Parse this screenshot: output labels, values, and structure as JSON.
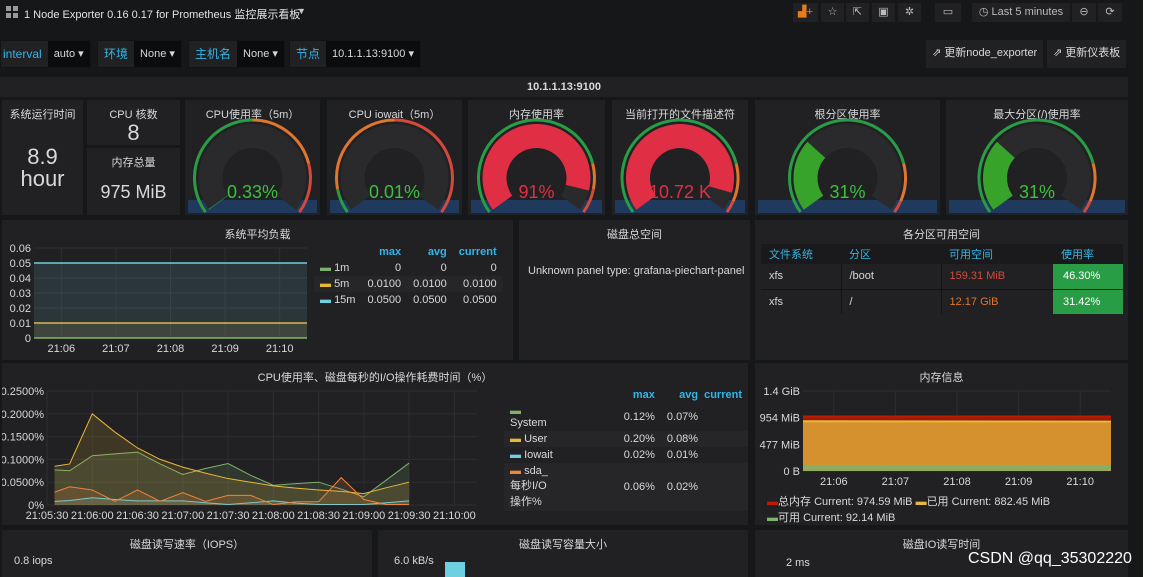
{
  "topbar": {
    "title": "1 Node Exporter 0.16 0.17 for Prometheus 监控展示看板",
    "time_range": "Last 5 minutes"
  },
  "variables": [
    {
      "label": "interval",
      "value": "auto"
    },
    {
      "label": "环境",
      "value": "None"
    },
    {
      "label": "主机名",
      "value": "None"
    },
    {
      "label": "节点",
      "value": "10.1.1.13:9100"
    }
  ],
  "links": [
    "更新node_exporter",
    "更新仪表板"
  ],
  "row_title": "10.1.1.13:9100",
  "stats": {
    "uptime": {
      "title": "系统运行时间",
      "value": "8.9",
      "unit": "hour"
    },
    "cpu_cores": {
      "title": "CPU 核数",
      "value": "8"
    },
    "mem_total": {
      "title": "内存总量",
      "value": "975 MiB"
    }
  },
  "gauges": [
    {
      "title": "CPU使用率（5m）",
      "value": "0.33%",
      "fraction": 0.0033,
      "color": "#299c46",
      "thresholds": [
        [
          "#299c46",
          0.5
        ],
        [
          "#e0752d",
          0.8
        ],
        [
          "#d44a3a",
          1
        ]
      ]
    },
    {
      "title": "CPU iowait（5m）",
      "value": "0.01%",
      "fraction": 0.0001,
      "color": "#299c46",
      "thresholds": [
        [
          "#299c46",
          0.1
        ],
        [
          "#e0752d",
          0.5
        ],
        [
          "#d44a3a",
          1
        ]
      ]
    },
    {
      "title": "内存使用率",
      "value": "91%",
      "fraction": 0.91,
      "color": "#e02f44",
      "thresholds": [
        [
          "#299c46",
          0.8
        ],
        [
          "#e0752d",
          0.9
        ],
        [
          "#d44a3a",
          1
        ]
      ]
    },
    {
      "title": "当前打开的文件描述符",
      "value": "10.72 K",
      "fraction": 0.92,
      "color": "#e02f44",
      "thresholds": [
        [
          "#299c46",
          0.8
        ],
        [
          "#e0752d",
          0.95
        ],
        [
          "#d44a3a",
          1
        ]
      ]
    },
    {
      "title": "根分区使用率",
      "value": "31%",
      "fraction": 0.31,
      "color": "#37a32b",
      "thresholds": [
        [
          "#299c46",
          0.8
        ],
        [
          "#e0752d",
          0.95
        ],
        [
          "#d44a3a",
          1
        ]
      ]
    },
    {
      "title": "最大分区(/)使用率",
      "value": "31%",
      "fraction": 0.31,
      "color": "#37a32b",
      "thresholds": [
        [
          "#299c46",
          0.8
        ],
        [
          "#e0752d",
          0.95
        ],
        [
          "#d44a3a",
          1
        ]
      ]
    }
  ],
  "disk_total": {
    "title": "磁盘总空间",
    "message": "Unknown panel type: grafana-piechart-panel"
  },
  "partitions": {
    "title": "各分区可用空间",
    "columns": [
      "文件系统",
      "分区",
      "可用空间",
      "使用率"
    ],
    "rows": [
      [
        "xfs",
        "/boot",
        "159.31 MiB",
        "46.30%"
      ],
      [
        "xfs",
        "/",
        "12.17 GiB",
        "31.42%"
      ]
    ],
    "free_colors": [
      "#d44a3a",
      "#e0752d"
    ]
  },
  "chart_data": [
    {
      "id": "load",
      "type": "line",
      "title": "系统平均负载",
      "x": [
        "21:05:30",
        "21:10:30"
      ],
      "xticks": [
        "21:06",
        "21:07",
        "21:08",
        "21:09",
        "21:10"
      ],
      "yticks": [
        "0",
        "0.01",
        "0.02",
        "0.03",
        "0.04",
        "0.05",
        "0.06"
      ],
      "ylim": [
        0,
        0.06
      ],
      "legend_headers": [
        "max",
        "avg",
        "current"
      ],
      "series": [
        {
          "name": "1m",
          "color": "#7eb26d",
          "values": [
            0,
            0
          ],
          "max": "0",
          "avg": "0",
          "current": "0"
        },
        {
          "name": "5m",
          "color": "#eab839",
          "values": [
            0.01,
            0.01
          ],
          "max": "0.0100",
          "avg": "0.0100",
          "current": "0.0100"
        },
        {
          "name": "15m",
          "color": "#6ed0e0",
          "values": [
            0.05,
            0.05
          ],
          "max": "0.0500",
          "avg": "0.0500",
          "current": "0.0500"
        }
      ]
    },
    {
      "id": "cpu",
      "type": "area",
      "title": "CPU使用率、磁盘每秒的I/O操作耗费时间（%）",
      "x": [
        "21:05:35",
        "21:05:45",
        "21:06:00",
        "21:06:15",
        "21:06:30",
        "21:06:45",
        "21:07:00",
        "21:07:15",
        "21:07:30",
        "21:07:45",
        "21:08:00",
        "21:08:15",
        "21:08:30",
        "21:08:45",
        "21:09:00",
        "21:09:15",
        "21:09:30"
      ],
      "xticks": [
        "21:05:30",
        "21:06:00",
        "21:06:30",
        "21:07:00",
        "21:07:30",
        "21:08:00",
        "21:08:30",
        "21:09:00",
        "21:09:30",
        "21:10:00"
      ],
      "yticks": [
        "0%",
        "0.0500%",
        "0.1000%",
        "0.1500%",
        "0.2000%",
        "0.2500%"
      ],
      "ylim": [
        0,
        0.25
      ],
      "legend_headers": [
        "max",
        "avg",
        "current"
      ],
      "series": [
        {
          "name": "System",
          "color": "#7eb26d",
          "values": [
            0.077,
            0.075,
            0.108,
            0.112,
            0.116,
            0.09,
            0.067,
            0.08,
            0.091,
            0.065,
            0.043,
            0.047,
            0.05,
            0.035,
            0.018,
            0.055,
            0.092
          ],
          "max": "0.12%",
          "avg": "0.07%",
          "current": ""
        },
        {
          "name": "User",
          "color": "#eab839",
          "values": [
            0.085,
            0.09,
            0.2,
            0.16,
            0.125,
            0.1,
            0.083,
            0.07,
            0.058,
            0.05,
            0.042,
            0.037,
            0.033,
            0.03,
            0.025,
            0.038,
            0.05
          ],
          "max": "0.20%",
          "avg": "0.08%",
          "current": ""
        },
        {
          "name": "Iowait",
          "color": "#6ed0e0",
          "values": [
            0.008,
            0.01,
            0.016,
            0.012,
            0.009,
            0.009,
            0.009,
            0.005,
            0.001,
            0.005,
            0.009,
            0.004,
            0.001,
            0.001,
            0.001,
            0.005,
            0.009
          ],
          "max": "0.02%",
          "avg": "0.01%",
          "current": ""
        },
        {
          "name": "sda_每秒I/O操作%",
          "color": "#ef843c",
          "values": [
            0.028,
            0.04,
            0.033,
            0.008,
            0.033,
            0.008,
            0.027,
            0.008,
            0.021,
            0.021,
            0.001,
            0.007,
            0.007,
            0.06,
            0.012,
            0.001,
            0.001
          ],
          "max": "0.06%",
          "avg": "0.02%",
          "current": ""
        }
      ]
    },
    {
      "id": "mem",
      "type": "area",
      "title": "内存信息",
      "x": [
        "21:05:30",
        "21:10:30"
      ],
      "xticks": [
        "21:06",
        "21:07",
        "21:08",
        "21:09",
        "21:10"
      ],
      "yticks": [
        "0 B",
        "477 MiB",
        "954 MiB",
        "1.4 GiB"
      ],
      "ylim": [
        0,
        1431
      ],
      "series": [
        {
          "name": "总内存",
          "color": "#bf1b00",
          "values": [
            974.59,
            974.59
          ],
          "legend": "Current: 974.59 MiB"
        },
        {
          "name": "已用",
          "color": "#eab839",
          "values": [
            890,
            882.45
          ],
          "legend": "Current: 882.45 MiB"
        },
        {
          "name": "可用",
          "color": "#7eb26d",
          "values": [
            84,
            92.14
          ],
          "legend": "Current: 92.14 MiB"
        }
      ]
    }
  ],
  "bottom_panels": [
    {
      "title": "磁盘读写速率（IOPS）",
      "first_tick": "0.8 iops"
    },
    {
      "title": "磁盘读写容量大小",
      "first_tick": "6.0 kB/s"
    },
    {
      "title": "磁盘IO读写时间",
      "first_tick": "2 ms"
    }
  ],
  "watermark": "CSDN @qq_35302220"
}
